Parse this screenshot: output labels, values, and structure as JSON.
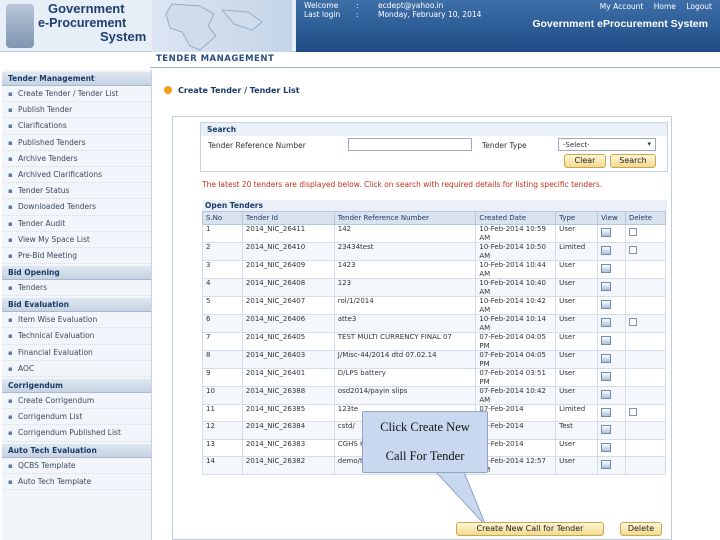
{
  "header": {
    "logo_lines": [
      "Government",
      "e-Procurement",
      "System"
    ],
    "welcome_label": "Welcome",
    "welcome_value": "ecdept@yahoo.in",
    "last_login_label": "Last login",
    "last_login_value": "Monday, February 10, 2014",
    "links": {
      "account": "My Account",
      "home": "Home",
      "logout": "Logout"
    },
    "system_title": "Government eProcurement System"
  },
  "section_title": "TENDER MANAGEMENT",
  "sidebar": {
    "groups": [
      {
        "title": "Tender Management",
        "items": [
          "Create Tender / Tender List",
          "Publish Tender",
          "Clarifications",
          "Published Tenders",
          "Archive Tenders",
          "Archived Clarifications",
          "Tender Status",
          "Downloaded Tenders",
          "Tender Audit",
          "View My Space List",
          "Pre-Bid Meeting"
        ]
      },
      {
        "title": "Bid Opening",
        "items": [
          "Tenders"
        ]
      },
      {
        "title": "Bid Evaluation",
        "items": [
          "Item Wise Evaluation",
          "Technical Evaluation",
          "Financial Evaluation",
          "AOC"
        ]
      },
      {
        "title": "Corrigendum",
        "items": [
          "Create Corrigendum",
          "Corrigendum List",
          "Corrigendum Published List"
        ]
      },
      {
        "title": "Auto Tech Evaluation",
        "items": [
          "QCBS Template",
          "Auto Tech Template"
        ]
      }
    ]
  },
  "breadcrumb": "Create Tender / Tender List",
  "search": {
    "title": "Search",
    "ref_label": "Tender Reference Number",
    "ref_value": "",
    "type_label": "Tender Type",
    "type_selected": "-Select-",
    "clear_label": "Clear",
    "search_label": "Search"
  },
  "notice": "The latest 20 tenders are displayed below. Click on search with required details for listing specific tenders.",
  "table": {
    "title": "Open Tenders",
    "headers": [
      "S.No",
      "Tender Id",
      "Tender Reference Number",
      "Created Date",
      "Type",
      "View",
      "Delete"
    ],
    "rows": [
      [
        "1",
        "2014_NIC_26411",
        "142",
        "10-Feb-2014 10:59 AM",
        "User"
      ],
      [
        "2",
        "2014_NIC_26410",
        "23434test",
        "10-Feb-2014 10:50 AM",
        "Limited"
      ],
      [
        "3",
        "2014_NIC_26409",
        "1423",
        "10-Feb-2014 10:44 AM",
        "User"
      ],
      [
        "4",
        "2014_NIC_26408",
        "123",
        "10-Feb-2014 10:40 AM",
        "User"
      ],
      [
        "5",
        "2014_NIC_26407",
        "rol/1/2014",
        "10-Feb-2014 10:42 AM",
        "User"
      ],
      [
        "6",
        "2014_NIC_26406",
        "atte3",
        "10-Feb-2014 10:14 AM",
        "User"
      ],
      [
        "7",
        "2014_NIC_26405",
        "TEST MULTI CURRENCY FINAL 07",
        "07-Feb-2014 04:05 PM",
        "User"
      ],
      [
        "8",
        "2014_NIC_26403",
        "J/Misc-44/2014 dtd 07.02.14",
        "07-Feb-2014 04:05 PM",
        "User"
      ],
      [
        "9",
        "2014_NIC_26401",
        "D/LPS battery",
        "07-Feb-2014 03:51 PM",
        "User"
      ],
      [
        "10",
        "2014_NIC_26388",
        "osd2014/payin slips",
        "07-Feb-2014 10:42 AM",
        "User"
      ],
      [
        "11",
        "2014_NIC_26385",
        "123te",
        "07-Feb-2014",
        "Limited"
      ],
      [
        "12",
        "2014_NIC_26384",
        "cstd/",
        "07-Feb-2014",
        "Test"
      ],
      [
        "13",
        "2014_NIC_26383",
        "CGHS HOSP",
        "07-Feb-2014",
        "User"
      ],
      [
        "14",
        "2014_NIC_26382",
        "demo/test",
        "07-Feb-2014 12:57 AM",
        "User"
      ]
    ]
  },
  "callout": {
    "line1": "Click Create New",
    "line2": "Call For Tender"
  },
  "actions": {
    "create": "Create New Call for Tender",
    "delete": "Delete"
  }
}
